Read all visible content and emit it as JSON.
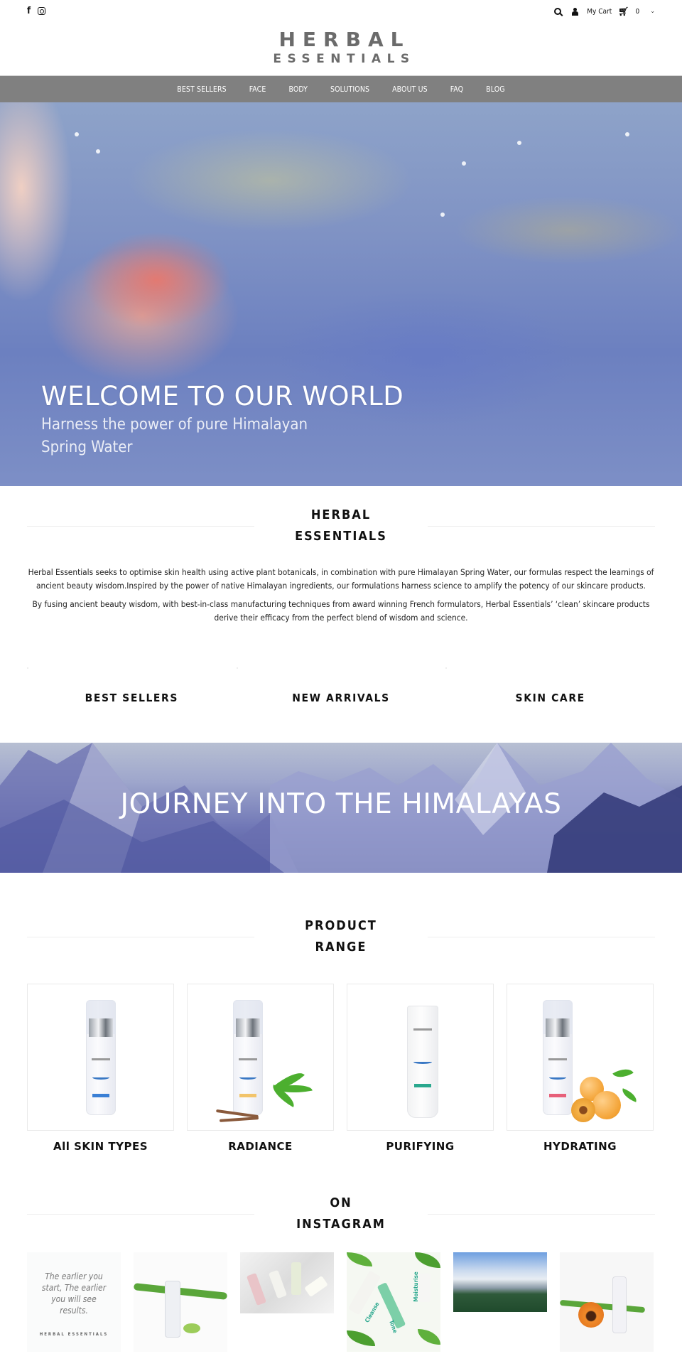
{
  "topbar": {
    "social": [
      {
        "name": "facebook",
        "glyph": "f"
      },
      {
        "name": "instagram",
        "glyph": ""
      }
    ],
    "cart_label": "My Cart",
    "cart_count": "0"
  },
  "logo": {
    "line1": "HERBAL",
    "line2": "ESSENTIALS"
  },
  "nav": {
    "items": [
      "BEST SELLERS",
      "FACE",
      "BODY",
      "SOLUTIONS",
      "ABOUT US",
      "FAQ",
      "BLOG"
    ]
  },
  "hero": {
    "title": "WELCOME TO OUR WORLD",
    "subtitle": "Harness the power of pure Himalayan Spring Water"
  },
  "about": {
    "heading_line1": "HERBAL",
    "heading_line2": "ESSENTIALS",
    "paragraph1": "Herbal Essentials seeks to optimise skin health using active plant botanicals, in combination with pure Himalayan Spring Water, our formulas respect the learnings of ancient beauty wisdom.Inspired by the power of native Himalayan ingredients, our formulations harness science to amplify the potency of our skincare products.",
    "paragraph2": "By fusing ancient beauty wisdom, with best-in-class manufacturing techniques from award winning French formulators, Herbal Essentials’ ‘clean’ skincare products derive their efficacy from the perfect blend of wisdom and science."
  },
  "collections": [
    "BEST SELLERS",
    "NEW ARRIVALS",
    "SKIN CARE"
  ],
  "banner": {
    "title": "JOURNEY INTO THE HIMALAYAS"
  },
  "product_range": {
    "heading_line1": "PRODUCT",
    "heading_line2": "RANGE",
    "products": [
      {
        "name": "All SKIN TYPES",
        "tag_color": "#3a7fd5"
      },
      {
        "name": "RADIANCE",
        "tag_color": "#f2c46b"
      },
      {
        "name": "PURIFYING",
        "tag_color": "#2aa88e"
      },
      {
        "name": "HYDRATING",
        "tag_color": "#e7607a"
      }
    ]
  },
  "instagram": {
    "heading_line1": "ON",
    "heading_line2": "INSTAGRAM",
    "quote": "The earlier you start, The earlier you will see results.",
    "quote_brand": "HERBAL ESSENTIALS",
    "post_labels": [
      "Cleanse",
      "Tone",
      "Moisturise"
    ]
  },
  "colors": {
    "nav_bg": "#808080",
    "logo": "#6b6b6b",
    "text": "#111111"
  }
}
